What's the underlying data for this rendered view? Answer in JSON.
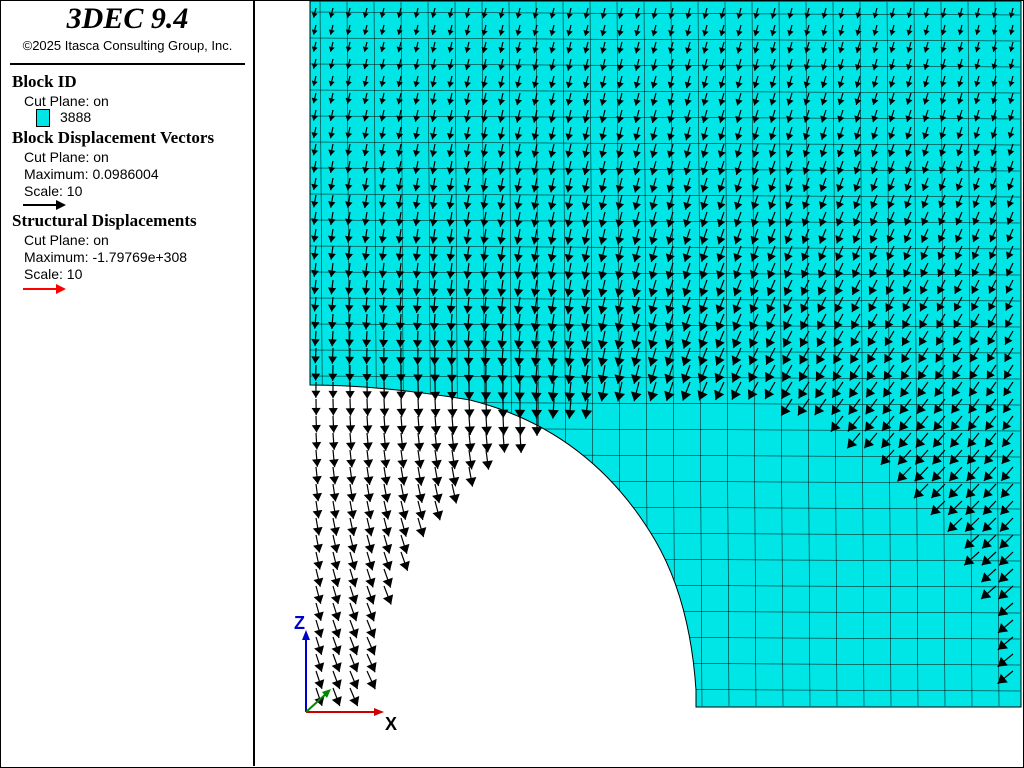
{
  "app": {
    "title": "3DEC 9.4",
    "copyright": "©2025 Itasca Consulting Group, Inc."
  },
  "legend": {
    "block_id": {
      "title": "Block  ID",
      "cut_plane": "Cut Plane: on",
      "swatch_label": "3888",
      "swatch_color": "#00e6e6"
    },
    "block_displacement": {
      "title": "Block Displacement Vectors",
      "cut_plane": "Cut Plane: on",
      "maximum": "Maximum: 0.0986004",
      "scale": "Scale: 10",
      "arrow_color": "#000000"
    },
    "structural_displacement": {
      "title": "Structural Displacements",
      "cut_plane": "Cut Plane: on",
      "maximum": "Maximum: -1.79769e+308",
      "scale": "Scale: 10",
      "arrow_color": "#ff0000"
    }
  },
  "axes": {
    "z_label": "Z",
    "x_label": "X",
    "z_color": "#0000cc",
    "x_color": "#cc0000",
    "y_color": "#008800"
  },
  "model": {
    "fill_color": "#00e6e6"
  }
}
